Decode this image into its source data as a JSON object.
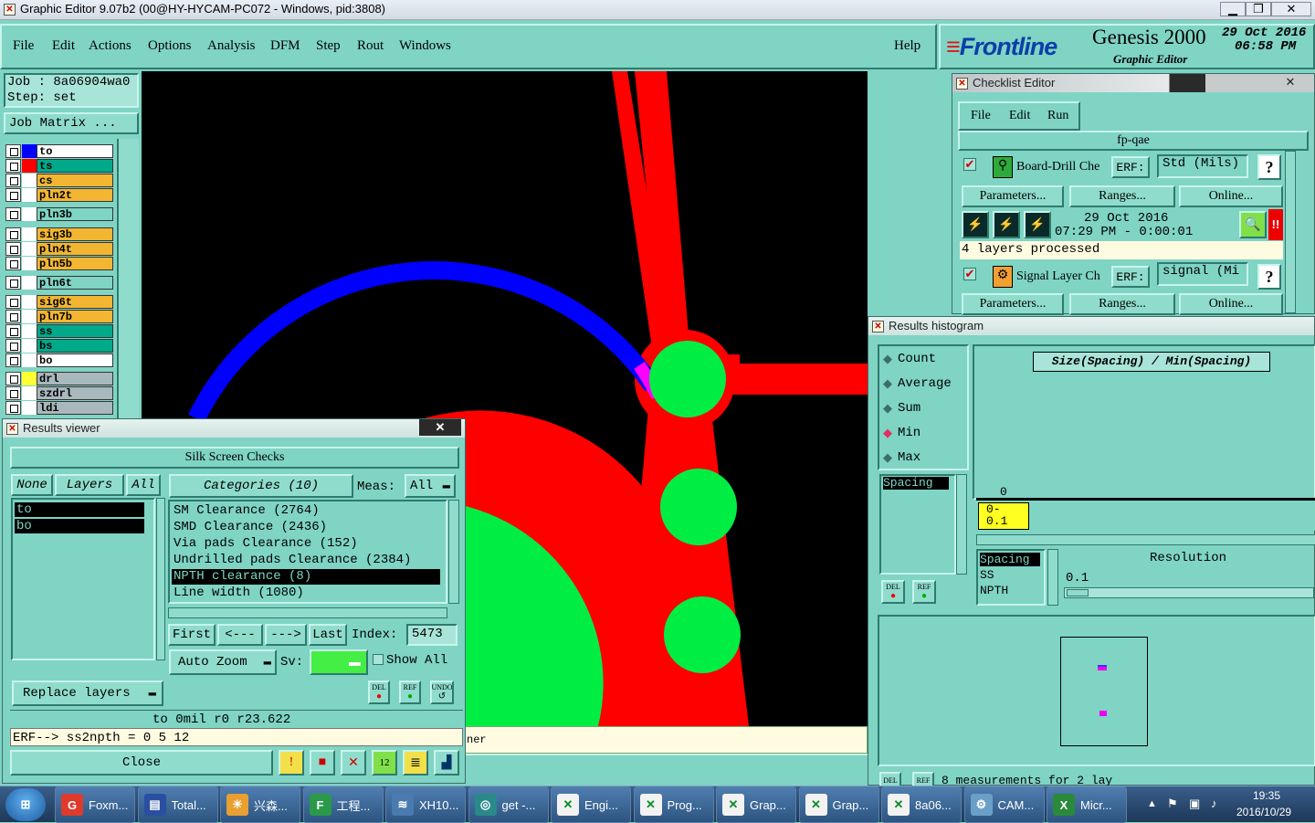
{
  "window_title": "Graphic Editor 9.07b2 (00@HY-HYCAM-PC072 - Windows, pid:3808)",
  "menu": {
    "file": "File",
    "edit": "Edit",
    "actions": "Actions",
    "options": "Options",
    "analysis": "Analysis",
    "dfm": "DFM",
    "step": "Step",
    "rout": "Rout",
    "windows": "Windows",
    "help": "Help"
  },
  "brand": {
    "logo": "Frontline",
    "product": "Genesis 2000",
    "subtitle": "Graphic Editor",
    "date": "29 Oct 2016",
    "time": "06:58 PM"
  },
  "job": {
    "job_label": "Job  : 8a06904wa0",
    "step_label": "Step: set",
    "matrix_button": "Job Matrix ..."
  },
  "layers": [
    {
      "name": "to",
      "color": "#ffffff",
      "swatch": "#0000ff"
    },
    {
      "name": "ts",
      "color": "#00a98a",
      "swatch": "#ff0000"
    },
    {
      "name": "cs",
      "color": "#f2b632",
      "swatch": "#ffffff"
    },
    {
      "name": "pln2t",
      "color": "#f2b632",
      "swatch": "#ffffff"
    },
    {
      "name": "pln3b",
      "color": "#7fd4c4",
      "swatch": "#ffffff"
    },
    {
      "name": "sig3b",
      "color": "#f2b632",
      "swatch": "#ffffff"
    },
    {
      "name": "pln4t",
      "color": "#f2b632",
      "swatch": "#ffffff"
    },
    {
      "name": "pln5b",
      "color": "#f2b632",
      "swatch": "#ffffff"
    },
    {
      "name": "pln6t",
      "color": "#7fd4c4",
      "swatch": "#ffffff"
    },
    {
      "name": "sig6t",
      "color": "#f2b632",
      "swatch": "#ffffff"
    },
    {
      "name": "pln7b",
      "color": "#f2b632",
      "swatch": "#ffffff"
    },
    {
      "name": "ss",
      "color": "#00a98a",
      "swatch": "#ffffff"
    },
    {
      "name": "bs",
      "color": "#00a98a",
      "swatch": "#ffffff"
    },
    {
      "name": "bo",
      "color": "#ffffff",
      "swatch": "#ffffff"
    },
    {
      "name": "drl",
      "color": "#a8b8bc",
      "swatch": "#ffff33"
    },
    {
      "name": "szdrl",
      "color": "#a8b8bc",
      "swatch": "#ffffff"
    },
    {
      "name": "ldi",
      "color": "#a8b8bc",
      "swatch": "#ffffff"
    }
  ],
  "results_viewer": {
    "title": "Results viewer",
    "header": "Silk Screen Checks",
    "none_btn": "None",
    "layers_btn": "Layers",
    "all_btn": "All",
    "layer_list": [
      "to",
      "bo"
    ],
    "categories_btn": "Categories (10)",
    "meas_label": "Meas:",
    "meas_value": "All",
    "categories": [
      "SM Clearance (2764)",
      "SMD Clearance (2436)",
      "Via pads Clearance (152)",
      "Undrilled pads Clearance (2384)",
      "NPTH clearance (8)",
      "Line width (1080)"
    ],
    "selected_category": "NPTH clearance (8)",
    "first": "First",
    "prev": "<---",
    "next": "--->",
    "last": "Last",
    "index_label": "Index:",
    "index_value": "5473",
    "auto_zoom": "Auto Zoom",
    "sv_label": "Sv:",
    "show_all": "Show All",
    "replace_layers": "Replace layers",
    "del": "DEL",
    "ref": "REF",
    "undo": "UNDO",
    "status": "to 0mil  r0  r23.622",
    "erf_line": "ERF--> ss2npth = 0 5 12",
    "close": "Close"
  },
  "checklist": {
    "title": "Checklist Editor",
    "file": "File",
    "edit": "Edit",
    "run": "Run",
    "name": "fp-qae",
    "item1": {
      "label": "Board-Drill Che",
      "erf_btn": "ERF:",
      "erf_value": "Std (Mils)",
      "help": "?",
      "params": "Parameters...",
      "ranges": "Ranges...",
      "online": "Online...",
      "date": "29 Oct 2016",
      "time": "07:29 PM - 0:00:01",
      "processed": "4 layers processed"
    },
    "item2": {
      "label": "Signal Layer Ch",
      "erf_btn": "ERF:",
      "erf_value": "signal (Mi",
      "help": "?",
      "params": "Parameters...",
      "ranges": "Ranges...",
      "online": "Online..."
    }
  },
  "histogram": {
    "title": "Results histogram",
    "options": [
      "Count",
      "Average",
      "Sum",
      "Min",
      "Max"
    ],
    "selected": "Min",
    "chart_title": "Size(Spacing) / Min(Spacing)",
    "zero": "0",
    "bin_label": "0-\n0.1",
    "list1": [
      "Spacing"
    ],
    "list2": [
      "Spacing",
      "SS",
      "NPTH"
    ],
    "resolution_label": "Resolution",
    "resolution_value": "0.1",
    "del": "DEL",
    "ref": "REF",
    "footer": "8 measurements for 2 lay"
  },
  "msg_fragment": "ner",
  "taskbar": {
    "items": [
      "Foxm...",
      "Total...",
      "兴森...",
      "工程...",
      "XH10...",
      "get -...",
      "Engi...",
      "Prog...",
      "Grap...",
      "Grap...",
      "8a06...",
      "CAM...",
      "Micr..."
    ],
    "clock_time": "19:35",
    "clock_date": "2016/10/29"
  }
}
